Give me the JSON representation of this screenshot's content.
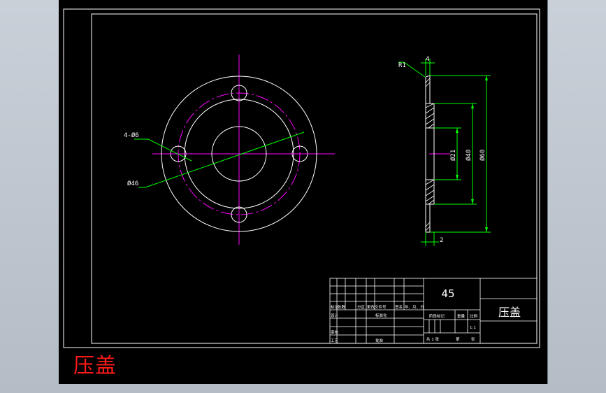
{
  "colors": {
    "background": "#000000",
    "outline": "#ffffff",
    "center_line": "#ff00ff",
    "dimension": "#00ff00",
    "caption": "#ff1a1a"
  },
  "drawing": {
    "front_view": {
      "hole_label": "4-Ø6",
      "bolt_circle_label": "Ø46"
    },
    "side_view": {
      "radius_label": "R1",
      "top_dim": "4",
      "bottom_dim": "2",
      "dia_small": "Ø21",
      "dia_mid": "Ø40",
      "dia_large": "Ø60"
    }
  },
  "title_block": {
    "material": "45",
    "part_name": "压盖",
    "headers": [
      "标记",
      "处数",
      "分区",
      "更改文件号",
      "签名",
      "年、月、日"
    ],
    "labels": {
      "design": "设计",
      "standardize": "标准化",
      "review": "审核",
      "process": "工艺",
      "approve": "批准",
      "stage_mark": "阶段标记",
      "weight": "重量",
      "scale": "比例",
      "scale_value": "1:1",
      "total_sheets": "共 1 张",
      "sheet_no": "第",
      "sheet_suffix": "张"
    }
  },
  "caption": "压盖"
}
